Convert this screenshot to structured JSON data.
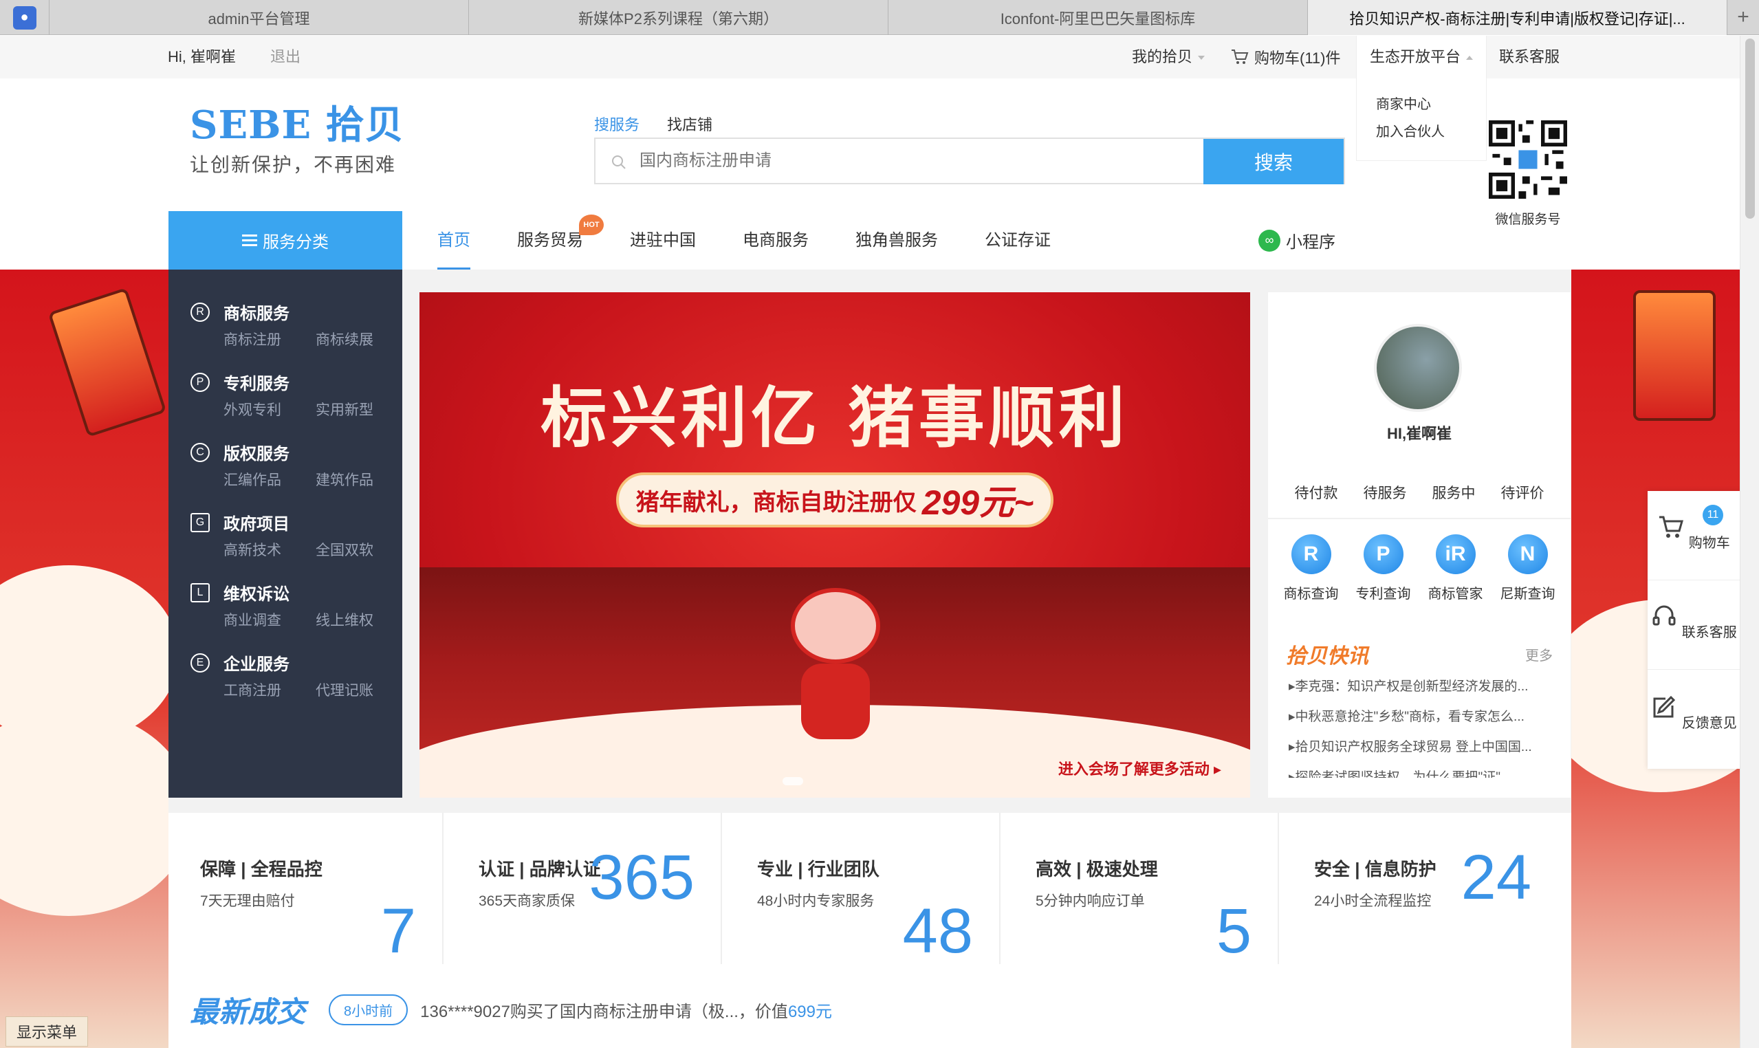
{
  "browser": {
    "tabs": [
      {
        "label": "admin平台管理"
      },
      {
        "label": "新媒体P2系列课程（第六期）"
      },
      {
        "label": "Iconfont-阿里巴巴矢量图标库"
      },
      {
        "label": "拾贝知识产权-商标注册|专利申请|版权登记|存证|..."
      }
    ],
    "new_tab": "+"
  },
  "topbar": {
    "greeting": "Hi,  崔啊崔",
    "logout": "退出",
    "my_sebe": "我的拾贝",
    "cart": "购物车(11)件",
    "eco_platform": "生态开放平台",
    "eco_menu": [
      "商家中心",
      "加入合伙人"
    ],
    "customer_service": "联系客服"
  },
  "header": {
    "logo_main": "SEBE 拾贝",
    "logo_slogan": "让创新保护，不再困难",
    "search_tabs": [
      "搜服务",
      "找店铺"
    ],
    "search_placeholder": "国内商标注册申请",
    "search_button": "搜索",
    "qr_caption": "微信服务号"
  },
  "nav": {
    "category_button": "服务分类",
    "items": [
      "首页",
      "服务贸易",
      "进驻中国",
      "电商服务",
      "独角兽服务",
      "公证存证"
    ],
    "hot_badge": "HOT",
    "mini_program": "小程序"
  },
  "categories": [
    {
      "icon": "R",
      "title": "商标服务",
      "subs": [
        "商标注册",
        "商标续展"
      ]
    },
    {
      "icon": "P",
      "title": "专利服务",
      "subs": [
        "外观专利",
        "实用新型"
      ]
    },
    {
      "icon": "C",
      "title": "版权服务",
      "subs": [
        "汇编作品",
        "建筑作品"
      ]
    },
    {
      "icon": "G",
      "title": "政府项目",
      "subs": [
        "高新技术",
        "全国双软"
      ]
    },
    {
      "icon": "L",
      "title": "维权诉讼",
      "subs": [
        "商业调查",
        "线上维权"
      ]
    },
    {
      "icon": "E",
      "title": "企业服务",
      "subs": [
        "工商注册",
        "代理记账"
      ]
    }
  ],
  "banner": {
    "headline": "标兴利亿 猪事顺利",
    "sub_prefix": "猪年献礼，商标自助注册仅",
    "price": "299元~",
    "more_link": "进入会场了解更多活动"
  },
  "user_panel": {
    "name": "HI,崔啊崔",
    "order_status": [
      "待付款",
      "待服务",
      "服务中",
      "待评价"
    ],
    "tools": [
      {
        "label": "商标查询",
        "glyph": "R"
      },
      {
        "label": "专利查询",
        "glyph": "P"
      },
      {
        "label": "商标管家",
        "glyph": "iR"
      },
      {
        "label": "尼斯查询",
        "glyph": "N"
      }
    ],
    "news_title": "拾贝快讯",
    "news_more": "更多",
    "news": [
      "李克强：知识产权是创新型经济发展的...",
      "中秋恶意抢注\"乡愁\"商标，看专家怎么...",
      "拾贝知识产权服务全球贸易 登上中国国...",
      "探险者试图坚持权，为什么要把\"证\"..."
    ]
  },
  "float_bar": {
    "cart_label": "购物车",
    "cart_count": "11",
    "service_label": "联系客服",
    "feedback_label": "反馈意见"
  },
  "stats": [
    {
      "title": "保障 | 全程品控",
      "desc": "7天无理由赔付",
      "number": "7"
    },
    {
      "title": "认证 | 品牌认证",
      "desc": "365天商家质保",
      "number": "365"
    },
    {
      "title": "专业 | 行业团队",
      "desc": "48小时内专家服务",
      "number": "48"
    },
    {
      "title": "高效 | 极速处理",
      "desc": "5分钟内响应订单",
      "number": "5"
    },
    {
      "title": "安全 | 信息防护",
      "desc": "24小时全流程监控",
      "number": "24"
    }
  ],
  "deals": {
    "title": "最新成交",
    "time_badge": "8小时前",
    "text": "136****9027购买了国内商标注册申请（极...，价值",
    "price": "699元"
  },
  "show_menu": "显示菜单",
  "colors": {
    "accent": "#3a93e6",
    "button": "#3aa5f0",
    "sidebar": "#2e3647",
    "festive_red": "#d4141b"
  }
}
